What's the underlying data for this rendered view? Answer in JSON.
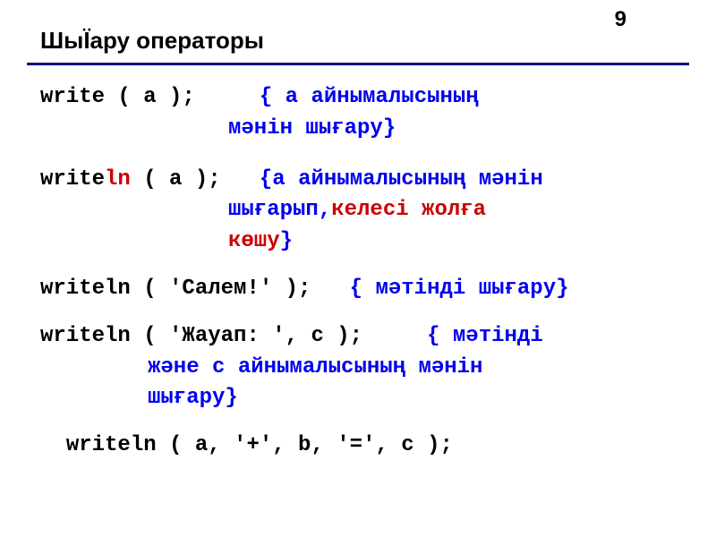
{
  "page_number": "9",
  "title": "ШыЇару операторы",
  "lines": {
    "l1a": "write ( a );",
    "l1b": "{ a айнымалысының",
    "l1c": "мәнін шығару}",
    "l2a": "write",
    "l2b": "ln",
    "l2c": " ( a );",
    "l2d": "{a айнымалысының мәнін",
    "l2e": "шығарып,",
    "l2f": "келесі жолға",
    "l2g": "көшу",
    "l2h": "}",
    "l3a": "writeln ( 'Салем!' );",
    "l3b": "{ мәтінді шығару}",
    "l4a": "writeln ( 'Жауап: ', c );",
    "l4b": "{ мәтінді",
    "l4c": "және c айнымалысының мәнін",
    "l4d": "шығару}",
    "l5": "writeln ( a, '+', b, '=', c );"
  }
}
